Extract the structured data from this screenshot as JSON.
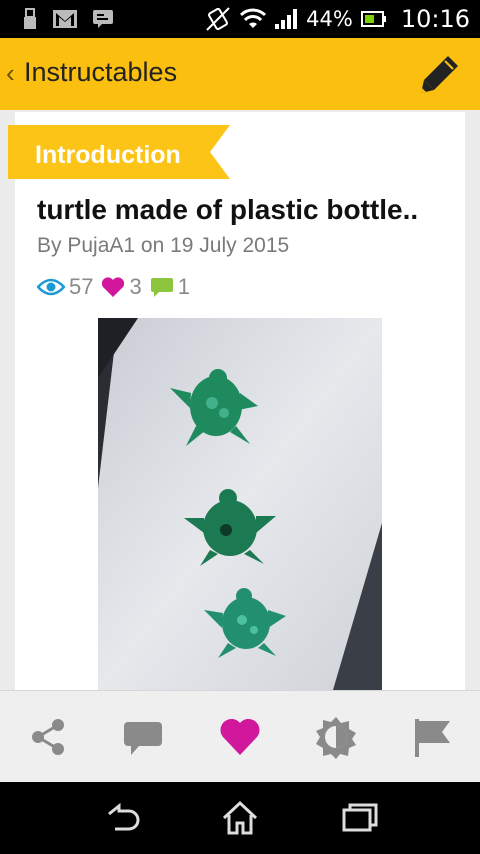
{
  "status_bar": {
    "battery": "44%",
    "time": "10:16",
    "icons": [
      "usb-icon",
      "gmail-icon",
      "message-icon",
      "vibrate-icon",
      "wifi-icon",
      "signal-icon",
      "battery-icon"
    ]
  },
  "action_bar": {
    "back": "‹",
    "title": "Instructables",
    "edit_icon": "pencil-icon"
  },
  "step": {
    "banner": "Introduction",
    "title": "turtle made of plastic bottle..",
    "byline": "By PujaA1 on 19 July 2015",
    "views": "57",
    "favorites": "3",
    "comments": "1"
  },
  "toolbar": {
    "items": [
      "share-icon",
      "comment-icon",
      "heart-icon",
      "brightness-icon",
      "flag-icon"
    ]
  },
  "nav_bar": {
    "items": [
      "back-icon",
      "home-icon",
      "recents-icon"
    ]
  },
  "colors": {
    "accent": "#fbbf0f",
    "banner": "#fcc417",
    "view_icon": "#1a9ad6",
    "heart": "#d1179b",
    "comment": "#8cc63f"
  }
}
